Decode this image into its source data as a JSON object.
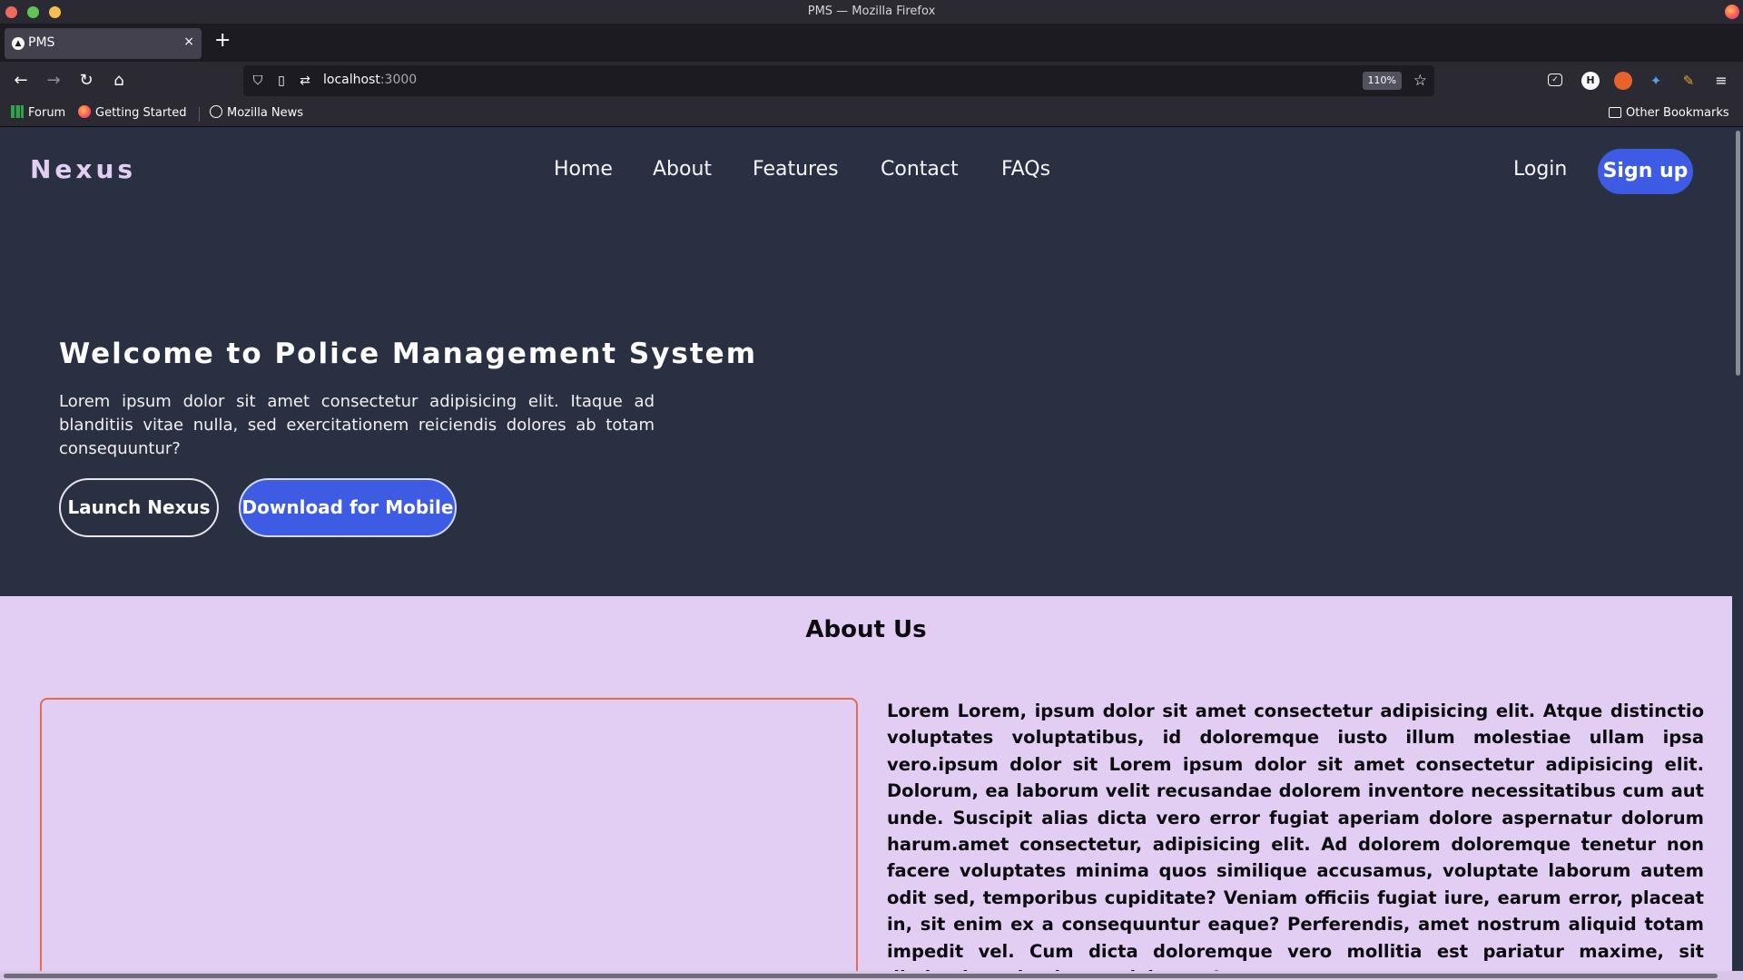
{
  "window": {
    "title": "PMS — Mozilla Firefox"
  },
  "tabs": [
    {
      "title": "PMS",
      "close": "×"
    }
  ],
  "new_tab": "+",
  "toolbar": {
    "url_host": "localhost",
    "url_port": ":3000",
    "zoom": "110%",
    "extension_h_label": "H"
  },
  "bookmarks": {
    "items": [
      {
        "label": "Forum"
      },
      {
        "label": "Getting Started"
      },
      {
        "label": "Mozilla News"
      }
    ],
    "other": "Other Bookmarks"
  },
  "site": {
    "brand": "Nexus",
    "nav": [
      "Home",
      "About",
      "Features",
      "Contact",
      "FAQs"
    ],
    "login": "Login",
    "signup": "Sign up"
  },
  "hero": {
    "title": "Welcome to Police Management System",
    "text": "Lorem ipsum dolor sit amet consectetur adipisicing elit. Itaque ad blanditiis vitae nulla, sed exercitationem reiciendis dolores ab totam consequuntur?",
    "launch_button": "Launch Nexus",
    "download_button": "Download for Mobile"
  },
  "about": {
    "title": "About Us",
    "text": "Lorem Lorem, ipsum dolor sit amet consectetur adipisicing elit. Atque distinctio voluptates voluptatibus, id doloremque iusto illum molestiae ullam ipsa vero.ipsum dolor sit Lorem ipsum dolor sit amet consectetur adipisicing elit. Dolorum, ea laborum velit recusandae dolorem inventore necessitatibus cum aut unde. Suscipit alias dicta vero error fugiat aperiam dolore aspernatur dolorum harum.amet consectetur, adipisicing elit. Ad dolorem doloremque tenetur non facere voluptates minima quos similique accusamus, voluptate laborum autem odit sed, temporibus cupiditate? Veniam officiis fugiat iure, earum error, placeat in, sit enim ex a consequuntur eaque? Perferendis, amet nostrum aliquid totam impedit vel. Cum dicta doloremque vero mollitia est pariatur maxime, sit distinctio molestiae aut laborum!"
  },
  "colors": {
    "hero_bg": "#283041",
    "accent": "#3d5be3",
    "about_bg": "#e2cef2",
    "media_border": "#e46d4f"
  }
}
